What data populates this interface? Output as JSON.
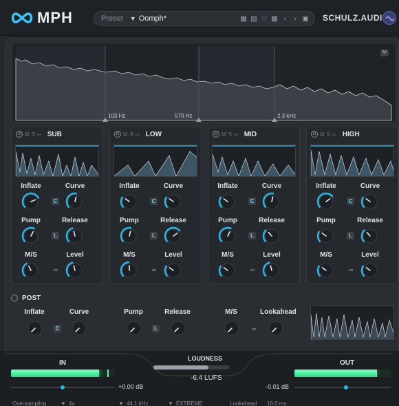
{
  "app": {
    "logo_text": "MPH",
    "brand": "SCHULZ.AUDIO"
  },
  "preset": {
    "label": "Preset",
    "name": "Oomph*"
  },
  "spectrum": {
    "freq_labels": [
      "103 Hz",
      "570 Hz",
      "2.3 kHz"
    ],
    "m_button": "M"
  },
  "bands": [
    {
      "name": "SUB",
      "knobs": {
        "inflate": "Inflate",
        "curve": "Curve",
        "pump": "Pump",
        "release": "Release",
        "ms": "M/S",
        "level": "Level"
      },
      "inflate_btn": "C",
      "pump_btn": "L"
    },
    {
      "name": "LOW",
      "knobs": {
        "inflate": "Inflate",
        "curve": "Curve",
        "pump": "Pump",
        "release": "Release",
        "ms": "M/S",
        "level": "Level"
      },
      "inflate_btn": "C",
      "pump_btn": "L"
    },
    {
      "name": "MID",
      "knobs": {
        "inflate": "Inflate",
        "curve": "Curve",
        "pump": "Pump",
        "release": "Release",
        "ms": "M/S",
        "level": "Level"
      },
      "inflate_btn": "C",
      "pump_btn": "L"
    },
    {
      "name": "HIGH",
      "knobs": {
        "inflate": "Inflate",
        "curve": "Curve",
        "pump": "Pump",
        "release": "Release",
        "ms": "M/S",
        "level": "Level"
      },
      "inflate_btn": "C",
      "pump_btn": "L"
    }
  ],
  "band_header_letters": {
    "m": "M",
    "s": "S"
  },
  "post": {
    "name": "POST",
    "inflate": "Inflate",
    "curve": "Curve",
    "pump": "Pump",
    "release": "Release",
    "ms": "M/S",
    "lookahead": "Lookahead",
    "inflate_btn": "C",
    "pump_btn": "L"
  },
  "io": {
    "in_label": "IN",
    "out_label": "OUT",
    "in_value": "+0.00 dB",
    "out_value": "-0.01 dB",
    "in_level": 0.85,
    "out_level": 0.85
  },
  "loudness": {
    "label": "LOUDNESS",
    "value": "-6.4 LUFS"
  },
  "status": {
    "oversampling": "Oversampling",
    "os_value": "4x",
    "rate": "44.1 kHz",
    "mode": "EXTREME",
    "lookahead": "Lookahead",
    "lookahead_value": "10.0 ms"
  },
  "colors": {
    "accent": "#2fb6e6",
    "meter": "#30d987"
  }
}
